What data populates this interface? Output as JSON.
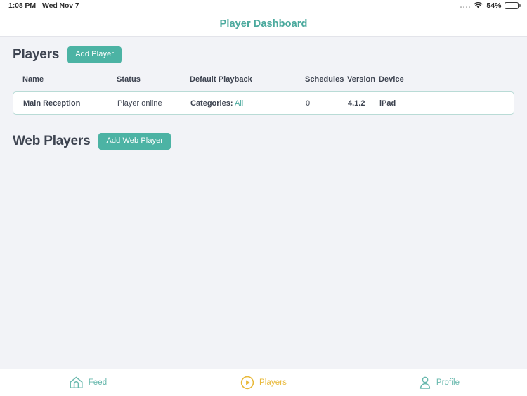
{
  "status_bar": {
    "time": "1:08 PM",
    "date": "Wed Nov 7",
    "battery_percent": "54%",
    "wifi_icon": "wifi-icon",
    "signal_icon": "signal-dots-icon",
    "battery_icon": "battery-icon"
  },
  "header": {
    "title": "Player Dashboard"
  },
  "players_section": {
    "title": "Players",
    "add_button": "Add Player",
    "columns": [
      "Name",
      "Status",
      "Default Playback",
      "Schedules",
      "Version",
      "Device"
    ],
    "rows": [
      {
        "name": "Main Reception",
        "status": "Player online",
        "playback_label": "Categories:",
        "playback_value": "All",
        "schedules": "0",
        "version": "4.1.2",
        "device": "iPad"
      }
    ]
  },
  "web_players_section": {
    "title": "Web Players",
    "add_button": "Add Web Player"
  },
  "tab_bar": {
    "tabs": [
      {
        "label": "Feed",
        "icon": "home-icon",
        "active": false
      },
      {
        "label": "Players",
        "icon": "play-circle-icon",
        "active": true
      },
      {
        "label": "Profile",
        "icon": "person-icon",
        "active": false
      }
    ]
  },
  "colors": {
    "accent_teal": "#4cb3a4",
    "title_teal": "#4aa99d",
    "muted_teal": "#86c7bd",
    "active_tab_gold": "#e9b93a",
    "page_background": "#f2f3f7",
    "card_border": "#b9dbd6",
    "text_dark": "#3d4350"
  }
}
